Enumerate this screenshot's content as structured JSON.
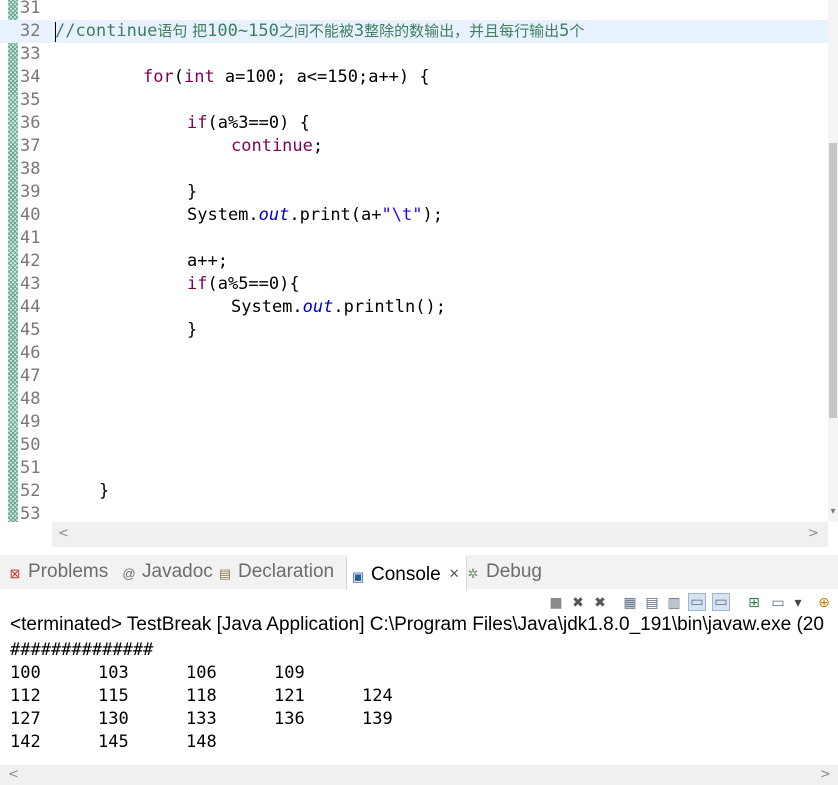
{
  "editor": {
    "line_numbers": [
      "31",
      "32",
      "33",
      "34",
      "35",
      "36",
      "37",
      "38",
      "39",
      "40",
      "41",
      "42",
      "43",
      "44",
      "45",
      "46",
      "47",
      "48",
      "49",
      "50",
      "51",
      "52",
      "53"
    ],
    "comment": {
      "slashes": "//",
      "keyword": "continue",
      "t1": "语句 把",
      "n1": "100~150",
      "t2": "之间不能被",
      "n2": "3",
      "t3": "整除的数输出，并且每行输出",
      "n3": "5",
      "t4": "个"
    },
    "line34": {
      "kw_for": "for",
      "open": "(",
      "kw_int": "int",
      "rest": " a=100; a<=150;a++) {"
    },
    "line36": {
      "kw_if": "if",
      "rest": "(a%3==0) {"
    },
    "line37": {
      "kw_continue": "continue",
      "semi": ";"
    },
    "line39": "}",
    "line40": {
      "pre": "System.",
      "field": "out",
      "mid": ".print(a+",
      "str": "\"\\t\"",
      "post": ");"
    },
    "line42": "a++;",
    "line43": {
      "kw_if": "if",
      "rest": "(a%5==0){"
    },
    "line44": {
      "pre": "System.",
      "field": "out",
      "post": ".println();"
    },
    "line45": "}",
    "line52": "}"
  },
  "panel": {
    "tabs": [
      {
        "label": "Problems",
        "icon": "problems-icon"
      },
      {
        "label": "Javadoc",
        "icon": "at-icon"
      },
      {
        "label": "Declaration",
        "icon": "declaration-icon"
      },
      {
        "label": "Console",
        "icon": "console-icon",
        "active": true,
        "close": "✕"
      },
      {
        "label": "Debug",
        "icon": "debug-icon"
      }
    ],
    "status": "<terminated> TestBreak [Java Application] C:\\Program Files\\Java\\jdk1.8.0_191\\bin\\javaw.exe (20",
    "output_header": "##############",
    "output_rows": [
      [
        "100",
        "103",
        "106",
        "109"
      ],
      [
        "112",
        "115",
        "118",
        "121",
        "124"
      ],
      [
        "127",
        "130",
        "133",
        "136",
        "139"
      ],
      [
        "142",
        "145",
        "148"
      ]
    ]
  },
  "colors": {
    "keyword": "#7f0055",
    "field": "#0000c0",
    "string": "#2a00ff",
    "comment": "#3f7f5f",
    "current_line": "#e8f2fe"
  }
}
